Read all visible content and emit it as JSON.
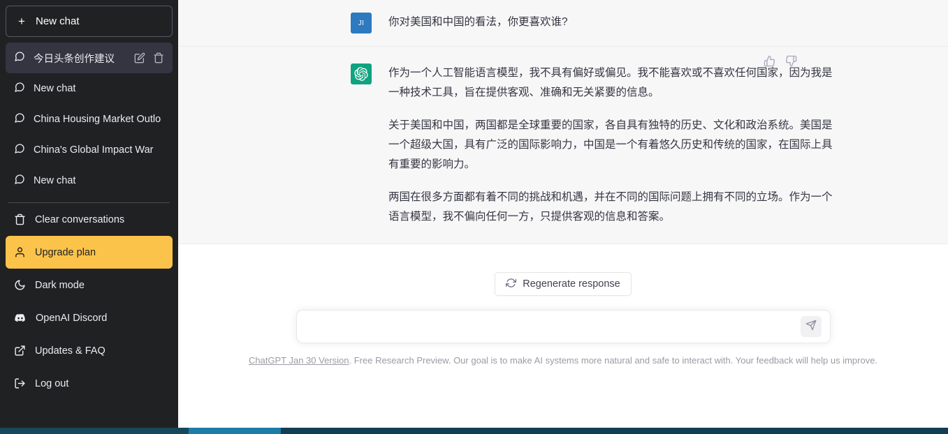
{
  "sidebar": {
    "new_chat_label": "New chat",
    "new_chat_icon": "plus-icon",
    "conversations": [
      {
        "title": "今日头条创作建议",
        "icon": "chat-bubble-icon",
        "active": true,
        "edit_icon": "pencil-icon",
        "delete_icon": "trash-icon"
      },
      {
        "title": "New chat",
        "icon": "chat-bubble-icon",
        "active": false
      },
      {
        "title": "China Housing Market Outlo",
        "icon": "chat-bubble-icon",
        "active": false
      },
      {
        "title": "China's Global Impact War",
        "icon": "chat-bubble-icon",
        "active": false
      },
      {
        "title": "New chat",
        "icon": "chat-bubble-icon",
        "active": false
      }
    ],
    "menu": [
      {
        "label": "Clear conversations",
        "icon": "trash-icon",
        "highlight": false
      },
      {
        "label": "Upgrade plan",
        "icon": "person-icon",
        "highlight": true
      },
      {
        "label": "Dark mode",
        "icon": "moon-icon",
        "highlight": false
      },
      {
        "label": "OpenAI Discord",
        "icon": "discord-icon",
        "highlight": false
      },
      {
        "label": "Updates & FAQ",
        "icon": "external-link-icon",
        "highlight": false
      },
      {
        "label": "Log out",
        "icon": "logout-icon",
        "highlight": false
      }
    ],
    "upgrade_color": "#fbc34a",
    "background_color": "#202123",
    "active_item_color": "#343541"
  },
  "conversation": {
    "messages": [
      {
        "role": "user",
        "avatar_initials": "JI",
        "avatar_color": "#2d7ac0",
        "paragraphs": [
          "你对美国和中国的看法，你更喜欢谁?"
        ]
      },
      {
        "role": "assistant",
        "avatar_icon": "openai-logo-icon",
        "avatar_color": "#10a37f",
        "paragraphs": [
          "作为一个人工智能语言模型，我不具有偏好或偏见。我不能喜欢或不喜欢任何国家，因为我是一种技术工具，旨在提供客观、准确和无关紧要的信息。",
          "关于美国和中国，两国都是全球重要的国家，各自具有独特的历史、文化和政治系统。美国是一个超级大国，具有广泛的国际影响力，中国是一个有着悠久历史和传统的国家，在国际上具有重要的影响力。",
          "两国在很多方面都有着不同的挑战和机遇，并在不同的国际问题上拥有不同的立场。作为一个语言模型，我不偏向任何一方，只提供客观的信息和答案。"
        ],
        "feedback": {
          "thumbs_up_icon": "thumbs-up-icon",
          "thumbs_down_icon": "thumbs-down-icon"
        }
      }
    ]
  },
  "composer": {
    "regenerate_label": "Regenerate response",
    "regenerate_icon": "refresh-icon",
    "input_value": "",
    "input_placeholder": "",
    "send_icon": "send-paper-plane-icon"
  },
  "footer": {
    "link_text": "ChatGPT Jan 30 Version",
    "rest_text": ". Free Research Preview. Our goal is to make AI systems more natural and safe to interact with. Your feedback will help us improve."
  },
  "taskbar": {
    "color": "#123d52",
    "active_segment_color": "#1c7ca8"
  }
}
